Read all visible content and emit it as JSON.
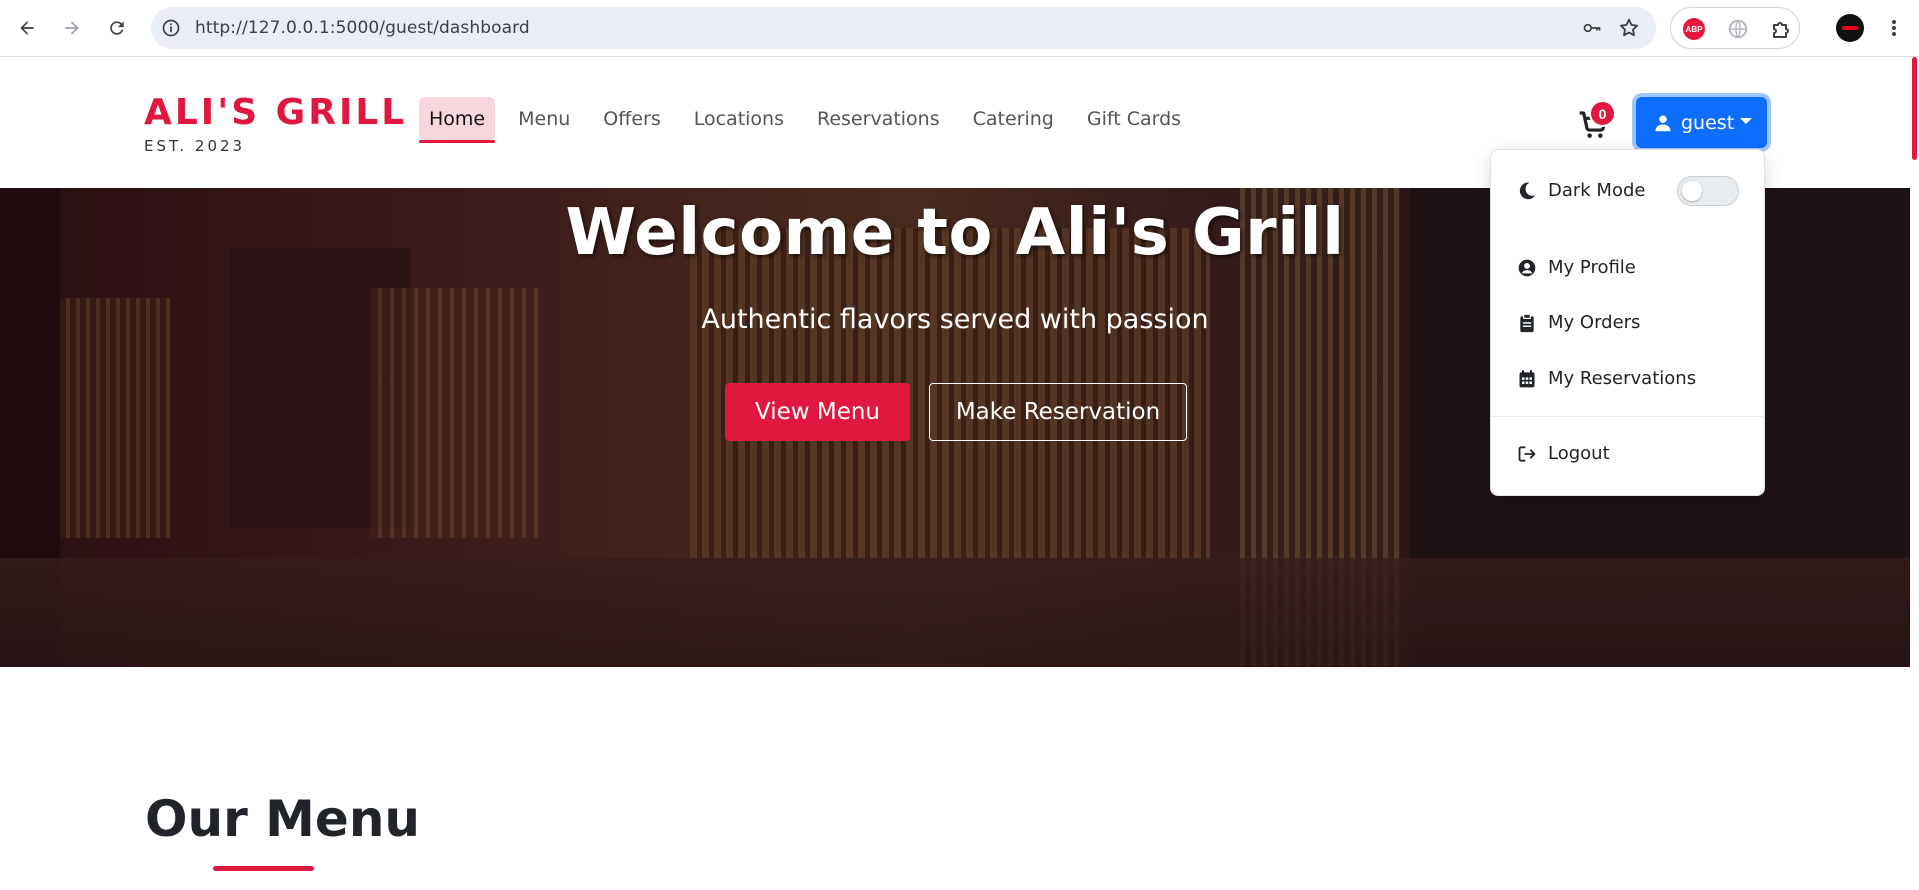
{
  "browser": {
    "url": "http://127.0.0.1:5000/guest/dashboard",
    "abp_label": "ABP"
  },
  "brand": {
    "name": "ALI'S GRILL",
    "est": "EST. 2023",
    "accent_color": "#e0173f"
  },
  "nav": {
    "items": [
      {
        "label": "Home",
        "active": true
      },
      {
        "label": "Menu"
      },
      {
        "label": "Offers"
      },
      {
        "label": "Locations"
      },
      {
        "label": "Reservations"
      },
      {
        "label": "Catering"
      },
      {
        "label": "Gift Cards"
      }
    ],
    "cart_count": "0",
    "user_label": "guest",
    "user_button_color": "#0d6efd"
  },
  "hero": {
    "title": "Welcome to Ali's Grill",
    "subtitle": "Authentic flavors served with passion",
    "primary_button": "View Menu",
    "secondary_button": "Make Reservation"
  },
  "dropdown": {
    "dark_mode_label": "Dark Mode",
    "dark_mode_on": false,
    "items": [
      {
        "label": "My Profile",
        "icon": "user-circle-icon"
      },
      {
        "label": "My Orders",
        "icon": "clipboard-icon"
      },
      {
        "label": "My Reservations",
        "icon": "calendar-icon"
      }
    ],
    "logout_label": "Logout"
  },
  "section": {
    "title": "Our Menu"
  }
}
